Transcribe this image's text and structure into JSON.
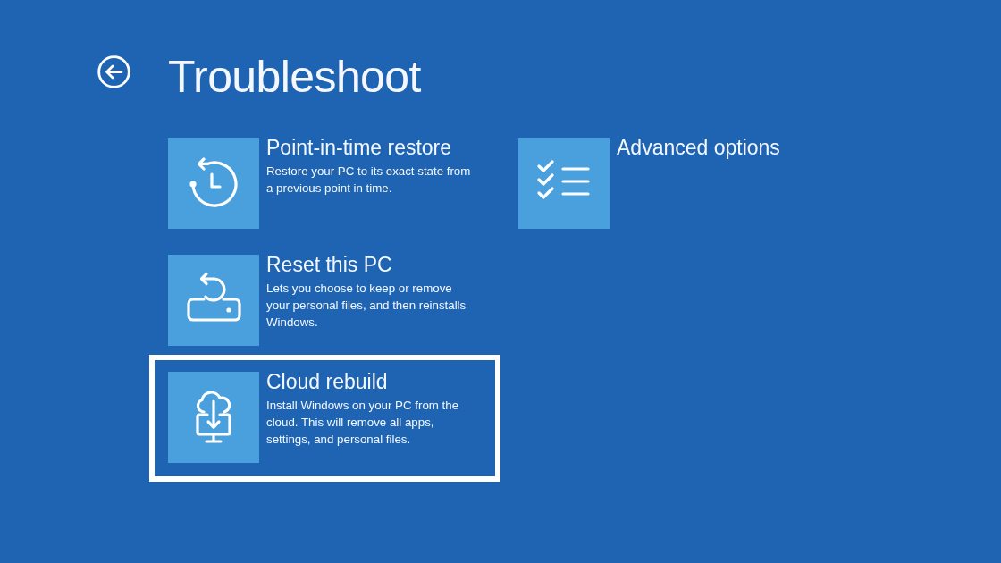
{
  "header": {
    "title": "Troubleshoot"
  },
  "options": [
    {
      "title": "Point-in-time restore",
      "description": "Restore your PC to its exact state from a previous point in time.",
      "selected": false
    },
    {
      "title": "Reset this PC",
      "description": "Lets you choose to keep or remove your personal files, and then reinstalls Windows.",
      "selected": false
    },
    {
      "title": "Cloud rebuild",
      "description": "Install Windows on your PC from the cloud. This will remove all apps, settings, and personal files.",
      "selected": true
    },
    {
      "title": "Advanced options",
      "selected": false
    }
  ]
}
